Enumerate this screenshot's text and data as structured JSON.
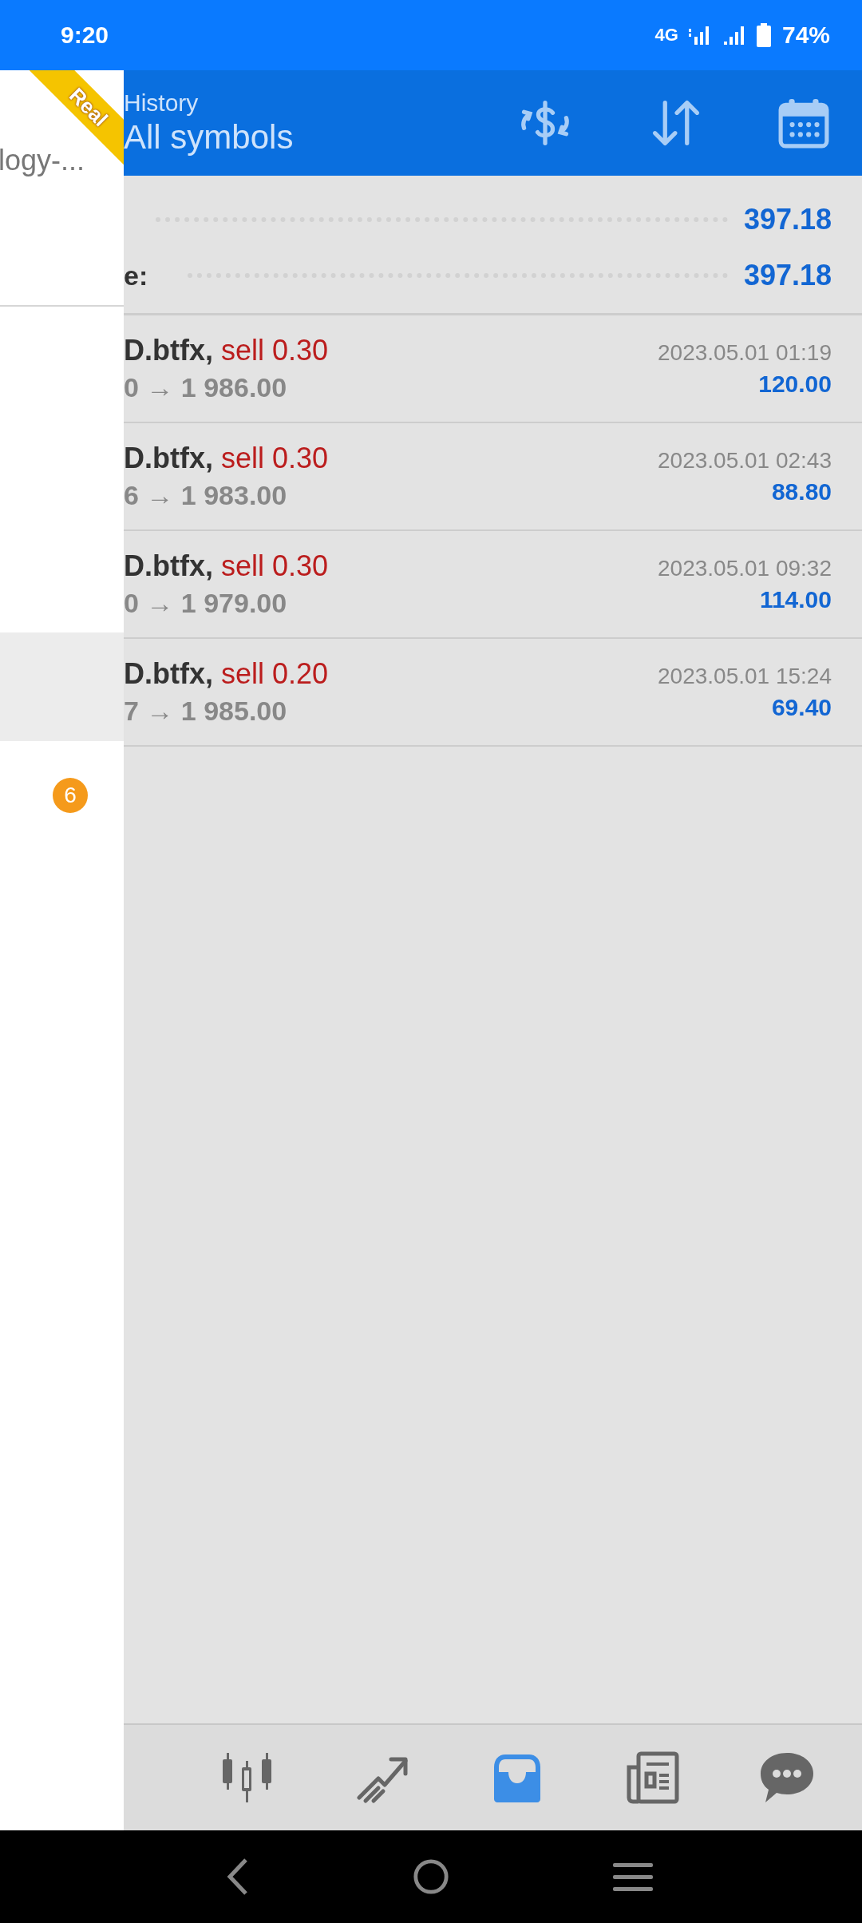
{
  "status_bar": {
    "time": "9:20",
    "network": "4G",
    "battery": "74%"
  },
  "drawer": {
    "account": "logy-...",
    "ribbon": "Real",
    "items": [
      {
        "selected": true
      },
      {
        "selected": false,
        "badge": "6"
      }
    ]
  },
  "header": {
    "title": "History",
    "subtitle": "All symbols"
  },
  "summary": [
    {
      "value": "397.18"
    },
    {
      "label": "e:",
      "value": "397.18"
    }
  ],
  "trades": [
    {
      "symbol": "D.btfx,",
      "side": "sell 0.30",
      "prices": "0 → 1 986.00",
      "time": "2023.05.01 01:19",
      "profit": "120.00"
    },
    {
      "symbol": "D.btfx,",
      "side": "sell 0.30",
      "prices": "6 → 1 983.00",
      "time": "2023.05.01 02:43",
      "profit": "88.80"
    },
    {
      "symbol": "D.btfx,",
      "side": "sell 0.30",
      "prices": "0 → 1 979.00",
      "time": "2023.05.01 09:32",
      "profit": "114.00"
    },
    {
      "symbol": "D.btfx,",
      "side": "sell 0.20",
      "prices": "7 → 1 985.00",
      "time": "2023.05.01 15:24",
      "profit": "69.40"
    }
  ],
  "bottom_nav": [
    {
      "kind": "candles",
      "selected": false
    },
    {
      "kind": "trend",
      "selected": false
    },
    {
      "kind": "inbox",
      "selected": true
    },
    {
      "kind": "news",
      "selected": false
    },
    {
      "kind": "chat",
      "selected": false
    }
  ]
}
